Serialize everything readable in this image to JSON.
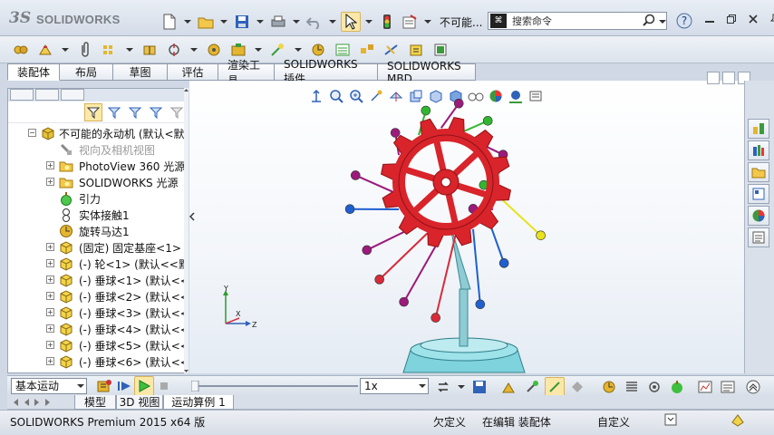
{
  "app": {
    "logo_prefix": "3S",
    "logo_text": "SOLIDWORKS"
  },
  "toolbar": {
    "rebuild_label": "不可能...",
    "search_badge": "⌘",
    "search_placeholder": "搜索命令",
    "help_icon": "question-icon"
  },
  "tabs": [
    {
      "label": "装配体",
      "active": true
    },
    {
      "label": "布局",
      "active": false
    },
    {
      "label": "草图",
      "active": false
    },
    {
      "label": "评估",
      "active": false
    },
    {
      "label": "渲染工具",
      "active": false
    },
    {
      "label": "SOLIDWORKS 插件",
      "active": false
    },
    {
      "label": "SOLIDWORKS MBD",
      "active": false
    }
  ],
  "tree": {
    "items": [
      {
        "label": "不可能的永动机 (默认<默",
        "icon": "assembly-icon",
        "level": 0,
        "expander": "−",
        "grey": false
      },
      {
        "label": "视向及相机视图",
        "icon": "camera-icon",
        "level": 1,
        "expander": "",
        "grey": true
      },
      {
        "label": "PhotoView 360 光源",
        "icon": "light-folder-icon",
        "level": 1,
        "expander": "+",
        "grey": false
      },
      {
        "label": "SOLIDWORKS 光源",
        "icon": "light-folder-icon",
        "level": 1,
        "expander": "+",
        "grey": false
      },
      {
        "label": "引力",
        "icon": "gravity-icon",
        "level": 1,
        "expander": "",
        "grey": false
      },
      {
        "label": "实体接触1",
        "icon": "contact-icon",
        "level": 1,
        "expander": "",
        "grey": false
      },
      {
        "label": "旋转马达1",
        "icon": "motor-icon",
        "level": 1,
        "expander": "",
        "grey": false
      },
      {
        "label": "(固定) 固定基座<1> (",
        "icon": "part-icon",
        "level": 1,
        "expander": "+",
        "grey": false
      },
      {
        "label": "(-) 轮<1> (默认<<默认",
        "icon": "part-icon",
        "level": 1,
        "expander": "+",
        "grey": false
      },
      {
        "label": "(-) 垂球<1> (默认<<默",
        "icon": "part-icon",
        "level": 1,
        "expander": "+",
        "grey": false
      },
      {
        "label": "(-) 垂球<2> (默认<<默",
        "icon": "part-icon",
        "level": 1,
        "expander": "+",
        "grey": false
      },
      {
        "label": "(-) 垂球<3> (默认<<默",
        "icon": "part-icon",
        "level": 1,
        "expander": "+",
        "grey": false
      },
      {
        "label": "(-) 垂球<4> (默认<<默",
        "icon": "part-icon",
        "level": 1,
        "expander": "+",
        "grey": false
      },
      {
        "label": "(-) 垂球<5> (默认<<默",
        "icon": "part-icon",
        "level": 1,
        "expander": "+",
        "grey": false
      },
      {
        "label": "(-) 垂球<6> (默认<<默",
        "icon": "part-icon",
        "level": 1,
        "expander": "+",
        "grey": false
      }
    ]
  },
  "motion": {
    "study_type": "基本运动",
    "speed": "1x",
    "slider_position": 0
  },
  "bottom_tabs": [
    {
      "label": "模型",
      "active": false
    },
    {
      "label": "3D 视图",
      "active": false
    },
    {
      "label": "运动算例 1",
      "active": true
    }
  ],
  "triad": {
    "x": "X",
    "y": "Y",
    "z": "Z"
  },
  "status": {
    "product": "SOLIDWORKS Premium 2015 x64 版",
    "definition": "欠定义",
    "editing": "在编辑 装配体",
    "units": "自定义"
  },
  "colors": {
    "wheel": "#d8242a",
    "base": "#7fd3dc",
    "stand": "#8ecbd3",
    "ball_purple": "#9b1a7a",
    "ball_green": "#2fb82f",
    "ball_yellow": "#e8e21a",
    "ball_blue": "#1f5fd0",
    "ball_red": "#d82a3a"
  }
}
